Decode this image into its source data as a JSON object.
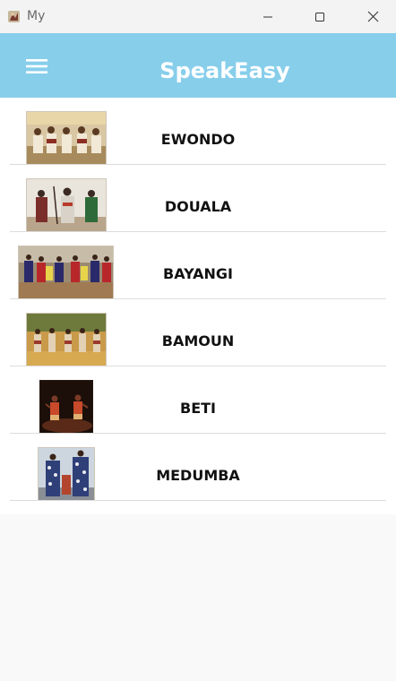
{
  "window": {
    "title": "My",
    "controls": {
      "minimize": "minimize-icon",
      "maximize": "maximize-icon",
      "close": "close-icon"
    }
  },
  "appbar": {
    "title": "SpeakEasy",
    "menu_icon": "hamburger-menu-icon",
    "background": "#87ceeb"
  },
  "languages": [
    {
      "name": "EWONDO",
      "image": "photo of seated ceremony group"
    },
    {
      "name": "DOUALA",
      "image": "photo of costumed dancers"
    },
    {
      "name": "BAYANGI",
      "image": "photo of colorful crowd dance"
    },
    {
      "name": "BAMOUN",
      "image": "photo of dancers on dirt ground"
    },
    {
      "name": "BETI",
      "image": "photo of dancers on dark stage"
    },
    {
      "name": "MEDUMBA",
      "image": "photo of performers in patterned costumes"
    }
  ]
}
